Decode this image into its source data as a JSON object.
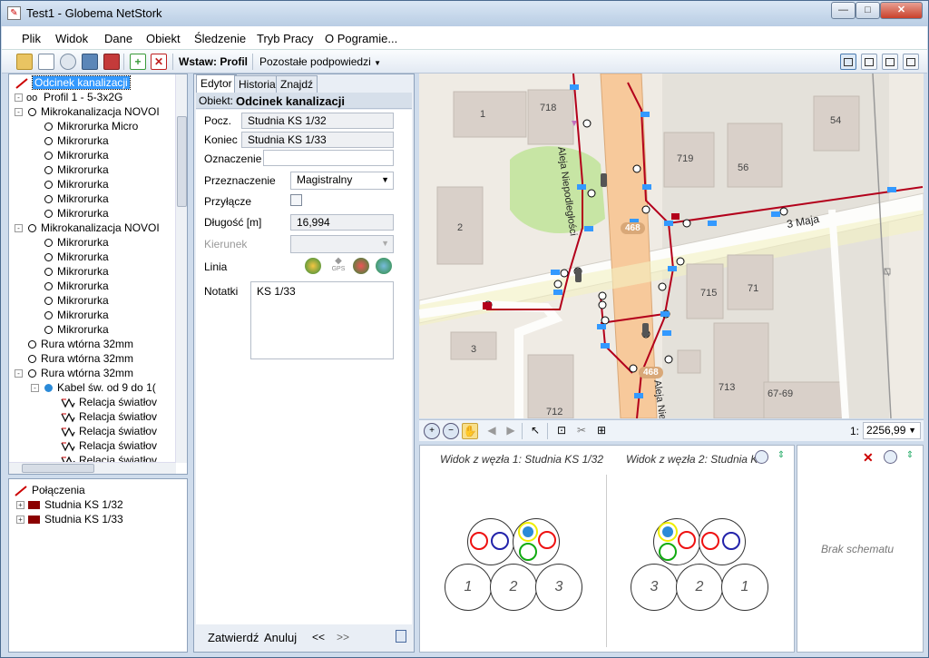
{
  "window": {
    "title": "Test1 - Globema NetStork",
    "buttons": {
      "minimize": "—",
      "maximize": "□",
      "close": "✕"
    }
  },
  "menu": [
    "Plik",
    "Widok",
    "Dane",
    "Obiekt",
    "Śledzenie",
    "Tryb Pracy",
    "O Pogramie..."
  ],
  "toolbar": {
    "insert_label": "Wstaw: Profil",
    "hints_label": "Pozostałe podpowiedzi",
    "icons": [
      "open-folder-icon",
      "document-icon",
      "print-preview-icon",
      "image-icon",
      "save-icon",
      "add-icon",
      "delete-icon"
    ]
  },
  "tree": {
    "items": [
      {
        "label": "Odcinek kanalizacji",
        "kind": "line",
        "indent": 0,
        "selected": true
      },
      {
        "label": "Profil 1 - 5-3x2G",
        "kind": "profile",
        "indent": 0,
        "expander": "-"
      },
      {
        "label": "Mikrokanalizacja NOVOI",
        "kind": "o",
        "indent": 1,
        "expander": "-"
      },
      {
        "label": "Mikrorurka Micro",
        "kind": "o",
        "indent": 2
      },
      {
        "label": "Mikrorurka",
        "kind": "o",
        "indent": 2
      },
      {
        "label": "Mikrorurka",
        "kind": "o",
        "indent": 2
      },
      {
        "label": "Mikrorurka",
        "kind": "o",
        "indent": 2
      },
      {
        "label": "Mikrorurka",
        "kind": "o",
        "indent": 2
      },
      {
        "label": "Mikrorurka",
        "kind": "o",
        "indent": 2
      },
      {
        "label": "Mikrorurka",
        "kind": "o",
        "indent": 2
      },
      {
        "label": "Mikrokanalizacja NOVOI",
        "kind": "o",
        "indent": 1,
        "expander": "-"
      },
      {
        "label": "Mikrorurka",
        "kind": "o",
        "indent": 2
      },
      {
        "label": "Mikrorurka",
        "kind": "o",
        "indent": 2
      },
      {
        "label": "Mikrorurka",
        "kind": "o",
        "indent": 2
      },
      {
        "label": "Mikrorurka",
        "kind": "o",
        "indent": 2
      },
      {
        "label": "Mikrorurka",
        "kind": "o",
        "indent": 2
      },
      {
        "label": "Mikrorurka",
        "kind": "o",
        "indent": 2
      },
      {
        "label": "Mikrorurka",
        "kind": "o",
        "indent": 2
      },
      {
        "label": "Rura wtórna 32mm",
        "kind": "o",
        "indent": 1
      },
      {
        "label": "Rura wtórna 32mm",
        "kind": "o",
        "indent": 1
      },
      {
        "label": "Rura wtórna 32mm",
        "kind": "o",
        "indent": 1,
        "expander": "-"
      },
      {
        "label": "Kabel św. od 9 do 1(",
        "kind": "b",
        "indent": 2,
        "expander": "-"
      },
      {
        "label": "Relacja światłov",
        "kind": "zig",
        "indent": 3
      },
      {
        "label": "Relacja światłov",
        "kind": "zig",
        "indent": 3
      },
      {
        "label": "Relacja światłov",
        "kind": "zig",
        "indent": 3
      },
      {
        "label": "Relacja światłov",
        "kind": "zig",
        "indent": 3
      },
      {
        "label": "Relacja światłov",
        "kind": "zig",
        "indent": 3
      }
    ]
  },
  "connections": {
    "title": "Połączenia",
    "items": [
      "Studnia KS 1/32",
      "Studnia KS 1/33"
    ]
  },
  "editor": {
    "tabs": [
      "Edytor",
      "Historia",
      "Znajdź"
    ],
    "object_label": "Obiekt:",
    "object_value": "Odcinek kanalizacji",
    "start_label": "Pocz.",
    "start_value": "Studnia KS 1/32",
    "end_label": "Koniec",
    "end_value": "Studnia KS 1/33",
    "mark_label": "Oznaczenie",
    "mark_value": "",
    "purpose_label": "Przeznaczenie",
    "purpose_value": "Magistralny",
    "connector_label": "Przyłącze",
    "length_label": "Długość [m]",
    "length_value": "16,994",
    "direction_label": "Kierunek",
    "line_label": "Linia",
    "gps_label": "GPS",
    "notes_label": "Notatki",
    "notes_value": "KS 1/33",
    "confirm": "Zatwierdź",
    "cancel": "Anuluj",
    "prev": "<<",
    "next": ">>"
  },
  "map": {
    "street_1": "3 Maja",
    "street_2": "Aleja Niepodległości",
    "street_3": "Aleja Nie",
    "road_badge": "468",
    "buildings": [
      "1",
      "718",
      "719",
      "56",
      "54",
      "2",
      "715",
      "71",
      "3",
      "713",
      "67-69",
      "712"
    ],
    "scale_prefix": "1:",
    "scale_value": "2256,99"
  },
  "schematic": {
    "view1": "Widok z węzła 1: Studnia KS 1/32",
    "view2": "Widok z węzła 2: Studnia KS",
    "left_numbers": [
      "1",
      "2",
      "3"
    ],
    "right_numbers": [
      "3",
      "2",
      "1"
    ],
    "empty_label": "Brak schematu"
  },
  "colors": {
    "accent": "#3399ff",
    "cable": "#b3001b",
    "road": "#f7c99b",
    "green_area": "#c7e5a4"
  }
}
